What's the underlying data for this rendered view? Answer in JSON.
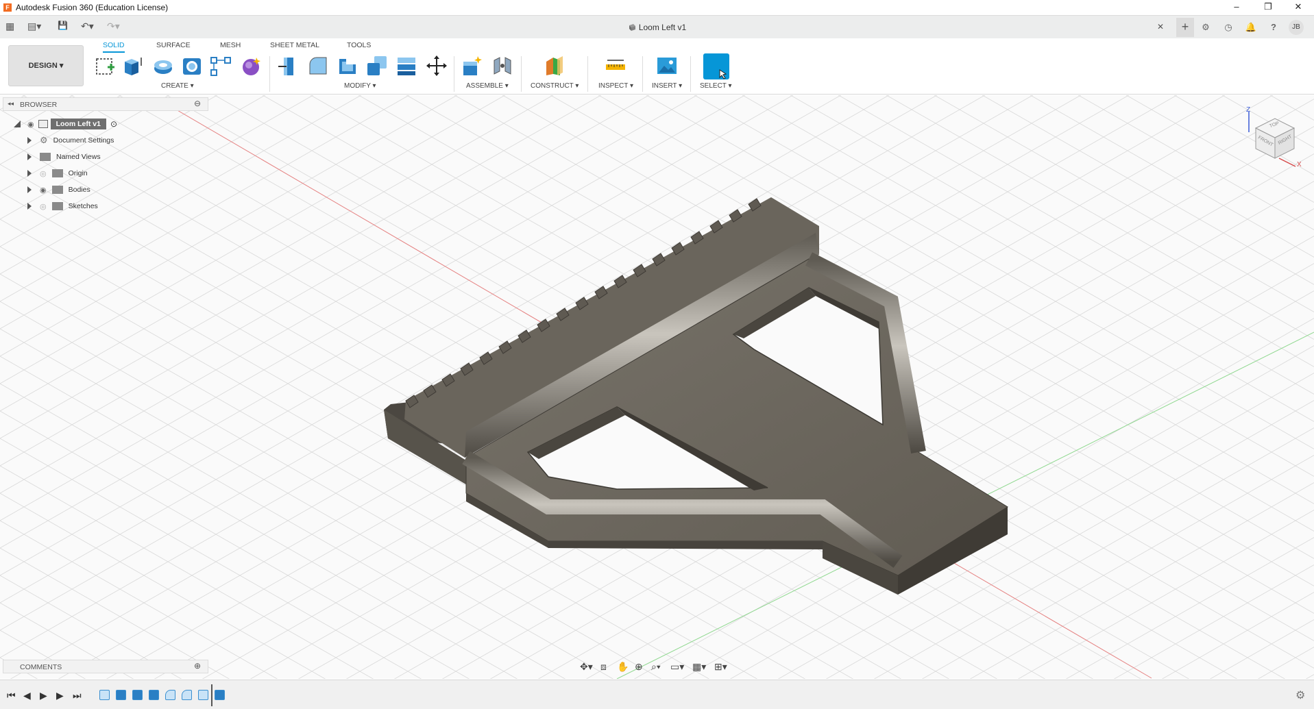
{
  "window": {
    "title": "Autodesk Fusion 360 (Education License)",
    "minimize": "–",
    "restore": "❐",
    "close": "✕"
  },
  "quick_access": {
    "grid": "▦",
    "file": "▤▾",
    "save": "💾",
    "undo": "↶▾",
    "redo": "↷▾"
  },
  "document": {
    "tab_title": "Loom Left v1",
    "close_tab": "✕",
    "new_tab": "+",
    "user_initials": "JB"
  },
  "ribbon": {
    "workspace_label": "DESIGN ▾",
    "tabs": [
      "SOLID",
      "SURFACE",
      "MESH",
      "SHEET METAL",
      "TOOLS"
    ],
    "active_tab": "SOLID",
    "groups": {
      "create": "CREATE ▾",
      "modify": "MODIFY ▾",
      "assemble": "ASSEMBLE ▾",
      "construct": "CONSTRUCT ▾",
      "inspect": "INSPECT ▾",
      "insert": "INSERT ▾",
      "select": "SELECT ▾"
    }
  },
  "browser": {
    "title": "BROWSER",
    "root_label": "Loom Left v1",
    "items": [
      {
        "label": "Document Settings",
        "icon": "gear-icon"
      },
      {
        "label": "Named Views",
        "icon": "folder-icon"
      },
      {
        "label": "Origin",
        "icon": "folder-icon"
      },
      {
        "label": "Bodies",
        "icon": "folder-icon"
      },
      {
        "label": "Sketches",
        "icon": "folder-icon"
      }
    ]
  },
  "viewcube": {
    "top": "TOP",
    "front": "FRONT",
    "right": "RIGHT",
    "axis_z": "Z",
    "axis_x": "X"
  },
  "comments": {
    "title": "COMMENTS"
  },
  "colors": {
    "accent": "#0696d7",
    "body": "#6b665c",
    "grid": "#dcdcdc"
  }
}
